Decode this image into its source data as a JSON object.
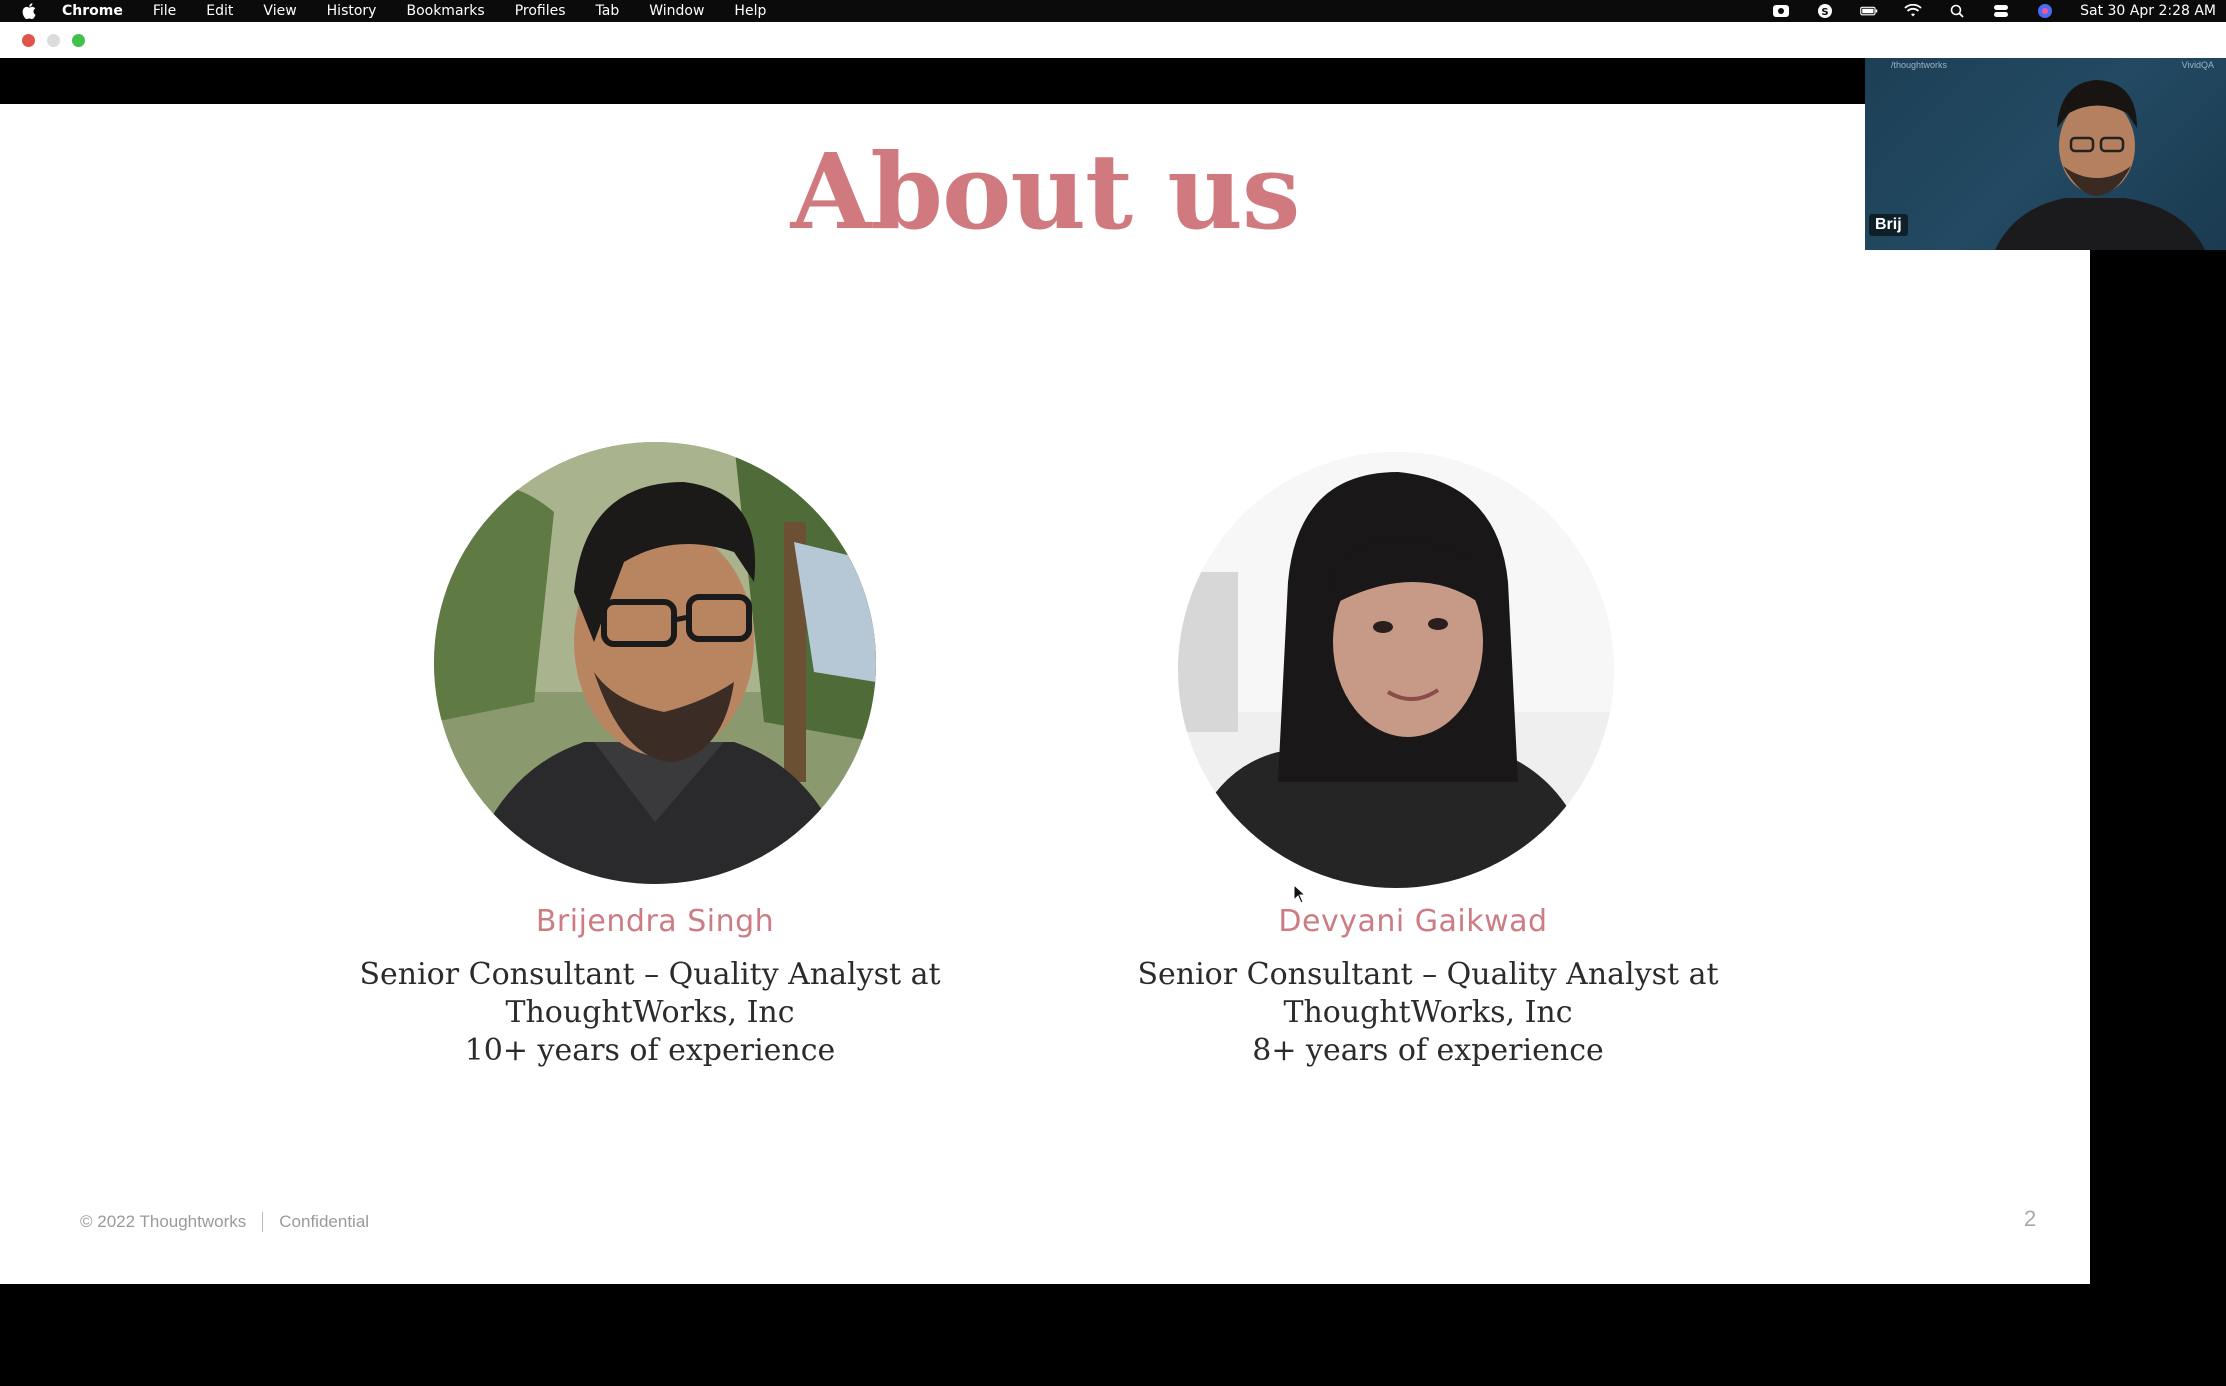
{
  "menubar": {
    "app_name": "Chrome",
    "items": [
      "File",
      "Edit",
      "View",
      "History",
      "Bookmarks",
      "Profiles",
      "Tab",
      "Window",
      "Help"
    ],
    "status_icons": [
      "screen-record-icon",
      "skype-icon",
      "battery-icon",
      "wifi-icon",
      "search-icon",
      "control-center-icon",
      "siri-icon"
    ],
    "clock": "Sat 30 Apr  2:28 AM"
  },
  "slide": {
    "title": "About us",
    "people": [
      {
        "name": "Brijendra Singh",
        "role_line1": "Senior Consultant – Quality Analyst at",
        "role_line2": "ThoughtWorks, Inc",
        "experience": "10+ years of experience"
      },
      {
        "name": "Devyani Gaikwad",
        "role_line1": "Senior Consultant – Quality Analyst at",
        "role_line2": "ThoughtWorks, Inc",
        "experience": "8+ years of experience"
      }
    ],
    "footer": {
      "copyright": "© 2022 Thoughtworks",
      "confidential": "Confidential"
    },
    "page_number": "2"
  },
  "video": {
    "participant_name": "Brij",
    "corner_left_text": "/thoughtworks",
    "corner_right_text": "VividQA"
  },
  "colors": {
    "title": "#d07a80",
    "name": "#cc7d83",
    "video_bg": "#1f4259"
  }
}
